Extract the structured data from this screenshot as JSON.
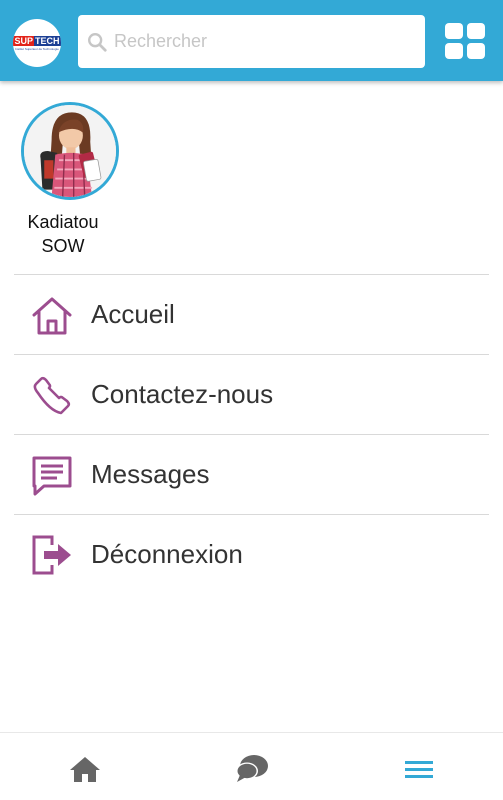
{
  "header": {
    "logo": {
      "word_left": "SUP",
      "word_right": "TECH",
      "tagline": "Institut Supérieur de Technologie"
    },
    "search": {
      "placeholder": "Rechercher",
      "value": "",
      "icon": "search-icon"
    },
    "apps_button_icon": "grid-icon",
    "color": "#33a9d6"
  },
  "profile": {
    "name": "Kadiatou\nSOW",
    "first_name": "Kadiatou",
    "last_name": "SOW",
    "avatar": "student-avatar"
  },
  "menu": {
    "items": [
      {
        "label": "Accueil",
        "icon": "home-icon"
      },
      {
        "label": "Contactez-nous",
        "icon": "phone-icon"
      },
      {
        "label": "Messages",
        "icon": "message-icon"
      },
      {
        "label": "Déconnexion",
        "icon": "logout-icon"
      }
    ],
    "icon_color": "#9c4d8f"
  },
  "bottom_nav": {
    "items": [
      {
        "icon": "home-icon"
      },
      {
        "icon": "chat-icon"
      },
      {
        "icon": "menu-icon",
        "active": true
      }
    ]
  }
}
